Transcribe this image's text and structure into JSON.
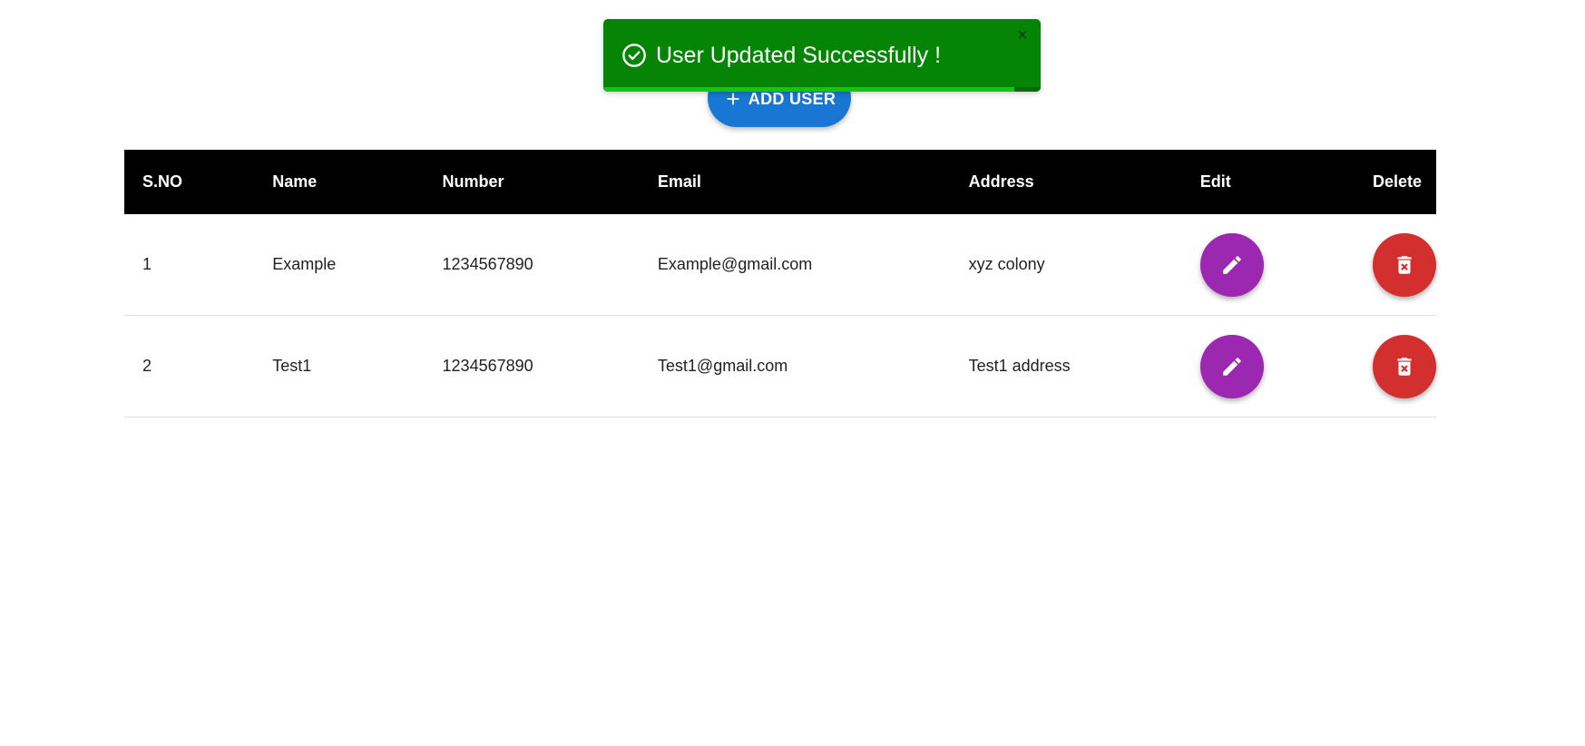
{
  "toast": {
    "message": "User Updated Successfully !",
    "close_glyph": "×",
    "progress": 0.94,
    "colors": {
      "background": "#068405",
      "progress": "#16c416"
    },
    "icons": {
      "status": "check-circle-icon",
      "close": "close-icon"
    }
  },
  "toolbar": {
    "add_user_label": "ADD USER",
    "add_user_icon": "plus-icon",
    "add_user_color": "#1976d2"
  },
  "table": {
    "headers": {
      "sno": "S.NO",
      "name": "Name",
      "number": "Number",
      "email": "Email",
      "address": "Address",
      "edit": "Edit",
      "delete": "Delete"
    },
    "rows": [
      {
        "sno": "1",
        "name": "Example",
        "number": "1234567890",
        "email": "Example@gmail.com",
        "address": "xyz colony"
      },
      {
        "sno": "2",
        "name": "Test1",
        "number": "1234567890",
        "email": "Test1@gmail.com",
        "address": "Test1 address"
      }
    ],
    "actions": {
      "edit_icon": "pencil-icon",
      "delete_icon": "trash-icon",
      "edit_color": "#9c27b0",
      "delete_color": "#d32f2f"
    }
  }
}
